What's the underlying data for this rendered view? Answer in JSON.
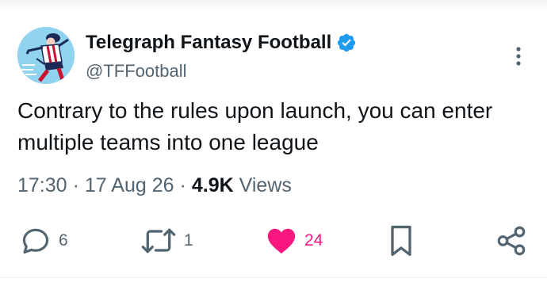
{
  "author": {
    "display_name": "Telegraph Fantasy Football",
    "handle": "@TFFootball",
    "verified_color": "#1d9bf0",
    "avatar_icon": "football-player-avatar"
  },
  "tweet": {
    "text": "Contrary to the rules upon launch, you can enter multiple teams into one league",
    "time": "17:30",
    "separator": "·",
    "date": "17 Aug 26",
    "views_count": "4.9K",
    "views_label": "Views"
  },
  "actions": {
    "reply_count": "6",
    "retweet_count": "1",
    "like_count": "24",
    "like_color": "#f91880",
    "icon_color": "#536471"
  }
}
